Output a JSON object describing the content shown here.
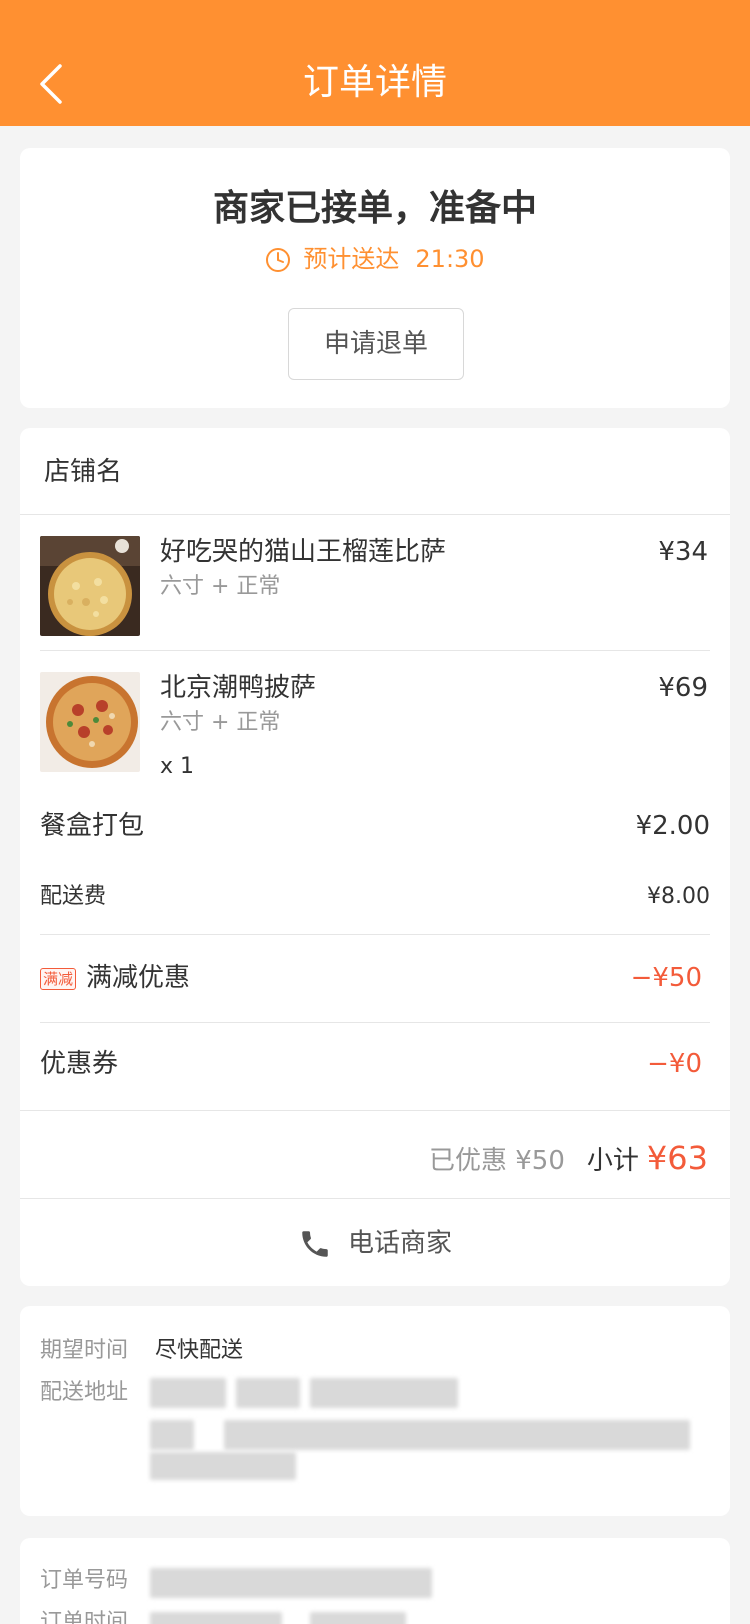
{
  "header": {
    "title": "订单详情"
  },
  "status": {
    "title": "商家已接单，准备中",
    "eta_label": "预计送达",
    "eta_time": "21:30",
    "refund_button": "申请退单"
  },
  "order": {
    "store_name": "店铺名",
    "items": [
      {
        "name": "好吃哭的猫山王榴莲比萨",
        "spec": "六寸 + 正常",
        "qty": "",
        "price": "¥34"
      },
      {
        "name": "北京潮鸭披萨",
        "spec": "六寸 + 正常",
        "qty": "x 1",
        "price": "¥69"
      }
    ],
    "packing": {
      "label": "餐盒打包",
      "value": "¥2.00"
    },
    "delivery_fee": {
      "label": "配送费",
      "value": "¥8.00"
    },
    "full_reduction": {
      "tag": "满减",
      "label": "满减优惠",
      "value": "−¥50"
    },
    "coupon": {
      "label": "优惠券",
      "value": "−¥0"
    },
    "saved": "已优惠 ¥50",
    "subtotal_label": "小计",
    "subtotal_value": "¥63",
    "call_merchant": "电话商家"
  },
  "delivery": {
    "expected_time_label": "期望时间",
    "expected_time_value": "尽快配送",
    "address_label": "配送地址"
  },
  "order_info": {
    "order_no_label": "订单号码",
    "order_time_label": "订单时间"
  },
  "colors": {
    "brand": "#ff9031",
    "discount": "#f35b3a"
  }
}
